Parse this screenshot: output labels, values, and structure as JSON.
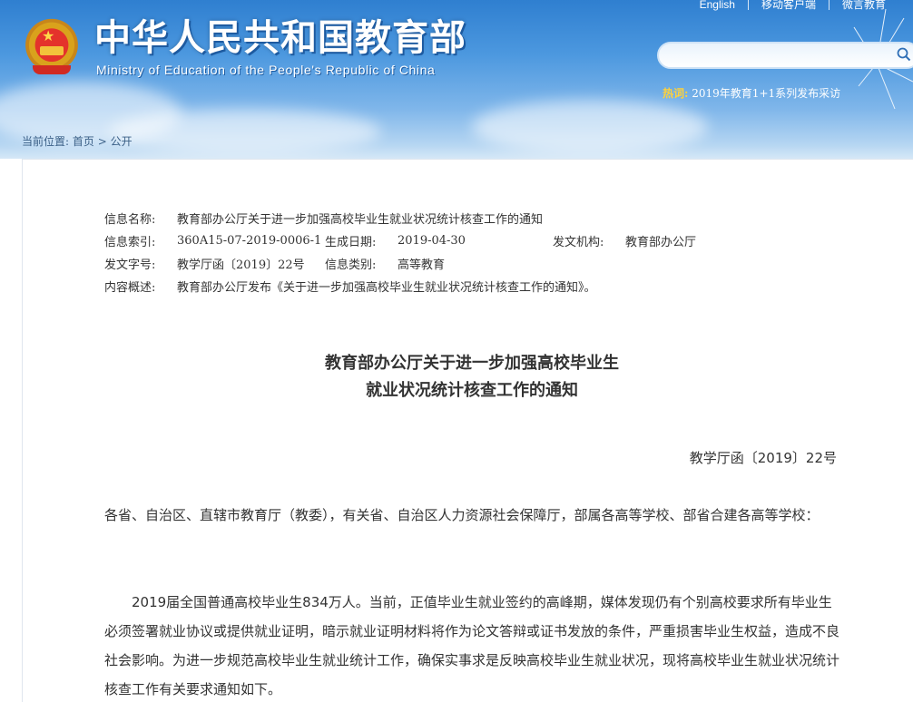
{
  "header": {
    "title": "中华人民共和国教育部",
    "subtitle": "Ministry of Education of the People's Republic of China",
    "links": [
      "English",
      "移动客户端",
      "微言教育"
    ],
    "search": {
      "placeholder": ""
    },
    "hot_label": "热词:",
    "hot_text": "2019年教育1+1系列发布采访"
  },
  "breadcrumb": {
    "prefix": "当前位置:",
    "home": "首页",
    "separator": ">",
    "current": "公开"
  },
  "meta": {
    "name_label": "信息名称:",
    "name_value": "教育部办公厅关于进一步加强高校毕业生就业状况统计核查工作的通知",
    "index_label": "信息索引:",
    "index_value": "360A15-07-2019-0006-1",
    "date_label": "生成日期:",
    "date_value": "2019-04-30",
    "org_label": "发文机构:",
    "org_value": "教育部办公厅",
    "docno_label": "发文字号:",
    "docno_value": "教学厅函〔2019〕22号",
    "category_label": "信息类别:",
    "category_value": "高等教育",
    "summary_label": "内容概述:",
    "summary_value": "教育部办公厅发布《关于进一步加强高校毕业生就业状况统计核查工作的通知》。"
  },
  "doc": {
    "title_line1": "教育部办公厅关于进一步加强高校毕业生",
    "title_line2": "就业状况统计核查工作的通知",
    "number": "教学厅函〔2019〕22号",
    "recipients": "各省、自治区、直辖市教育厅（教委），有关省、自治区人力资源社会保障厅，部属各高等学校、部省合建各高等学校：",
    "body": "2019届全国普通高校毕业生834万人。当前，正值毕业生就业签约的高峰期，媒体发现仍有个别高校要求所有毕业生必须签署就业协议或提供就业证明，暗示就业证明材料将作为论文答辩或证书发放的条件，严重损害毕业生权益，造成不良社会影响。为进一步规范高校毕业生就业统计工作，确保实事求是反映高校毕业生就业状况，现将高校毕业生就业状况统计核查工作有关要求通知如下。"
  },
  "colors": {
    "header_blue": "#2f7fd0",
    "hot_label": "#ffd23a",
    "breadcrumb": "#3a5f86"
  }
}
